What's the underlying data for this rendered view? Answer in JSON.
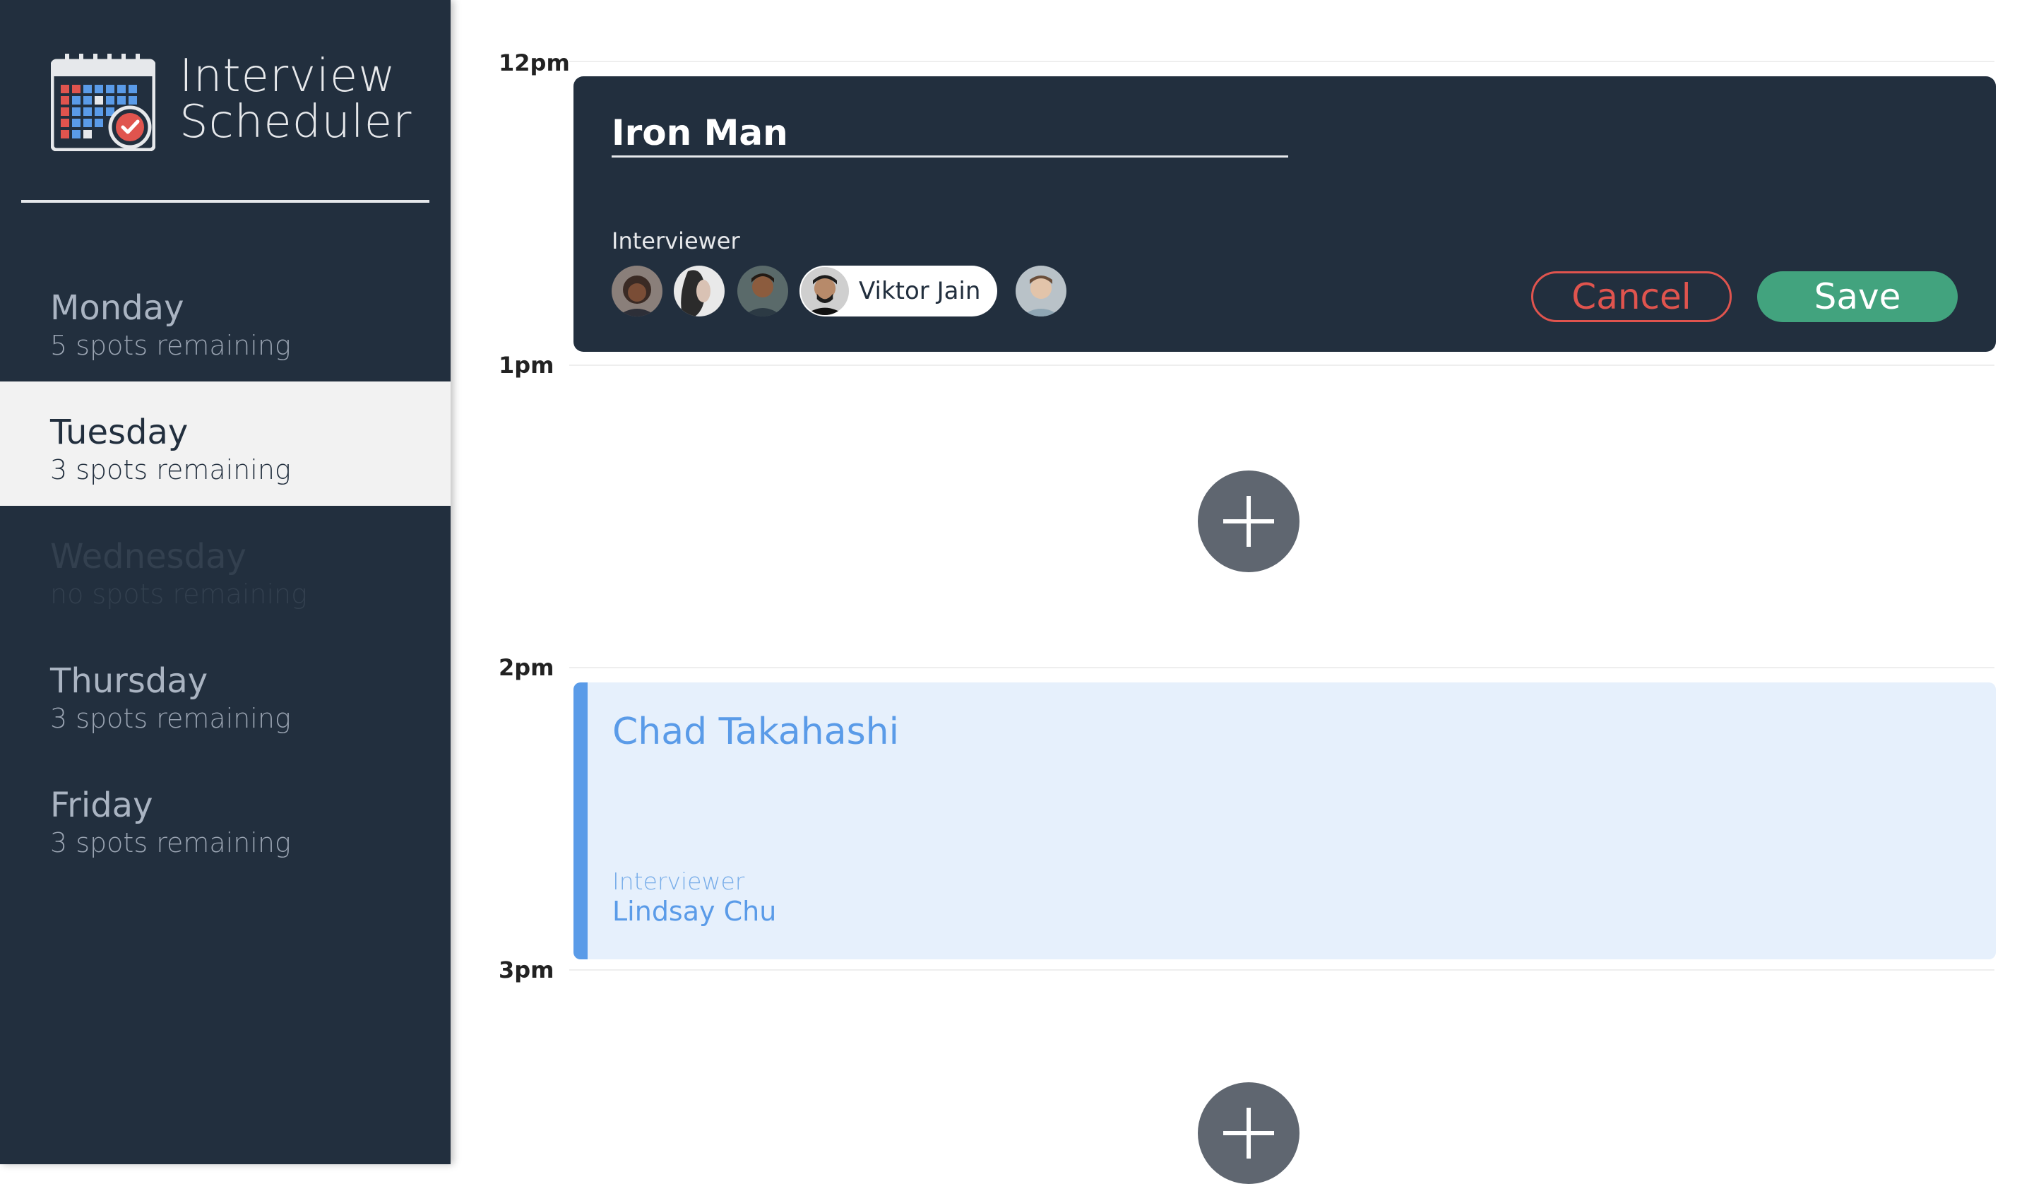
{
  "app": {
    "title_line1": "Interview",
    "title_line2": "Scheduler",
    "logo_icon": "calendar-check-icon"
  },
  "sidebar": {
    "days": [
      {
        "name": "Monday",
        "spots": "5 spots remaining",
        "state": "normal"
      },
      {
        "name": "Tuesday",
        "spots": "3 spots remaining",
        "state": "selected"
      },
      {
        "name": "Wednesday",
        "spots": "no spots remaining",
        "state": "full"
      },
      {
        "name": "Thursday",
        "spots": "3 spots remaining",
        "state": "normal"
      },
      {
        "name": "Friday",
        "spots": "3 spots remaining",
        "state": "normal"
      }
    ]
  },
  "schedule": {
    "times": [
      "12pm",
      "1pm",
      "2pm",
      "3pm"
    ],
    "editor": {
      "student_value": "Iron Man",
      "student_placeholder": "",
      "interviewer_label": "Interviewer",
      "selected_interviewer": "Viktor Jain",
      "cancel_label": "Cancel",
      "save_label": "Save"
    },
    "appointment": {
      "student": "Chad Takahashi",
      "interviewer_label": "Interviewer",
      "interviewer": "Lindsay Chu"
    },
    "add_icon": "plus-icon"
  },
  "colors": {
    "sidebar_bg": "#222f3e",
    "selected_bg": "#f2f2f2",
    "save": "#42a37e",
    "cancel": "#e0544e",
    "appointment_accent": "#5a9be8",
    "appointment_bg": "#e6f0fc",
    "add_button": "#5f6670"
  }
}
